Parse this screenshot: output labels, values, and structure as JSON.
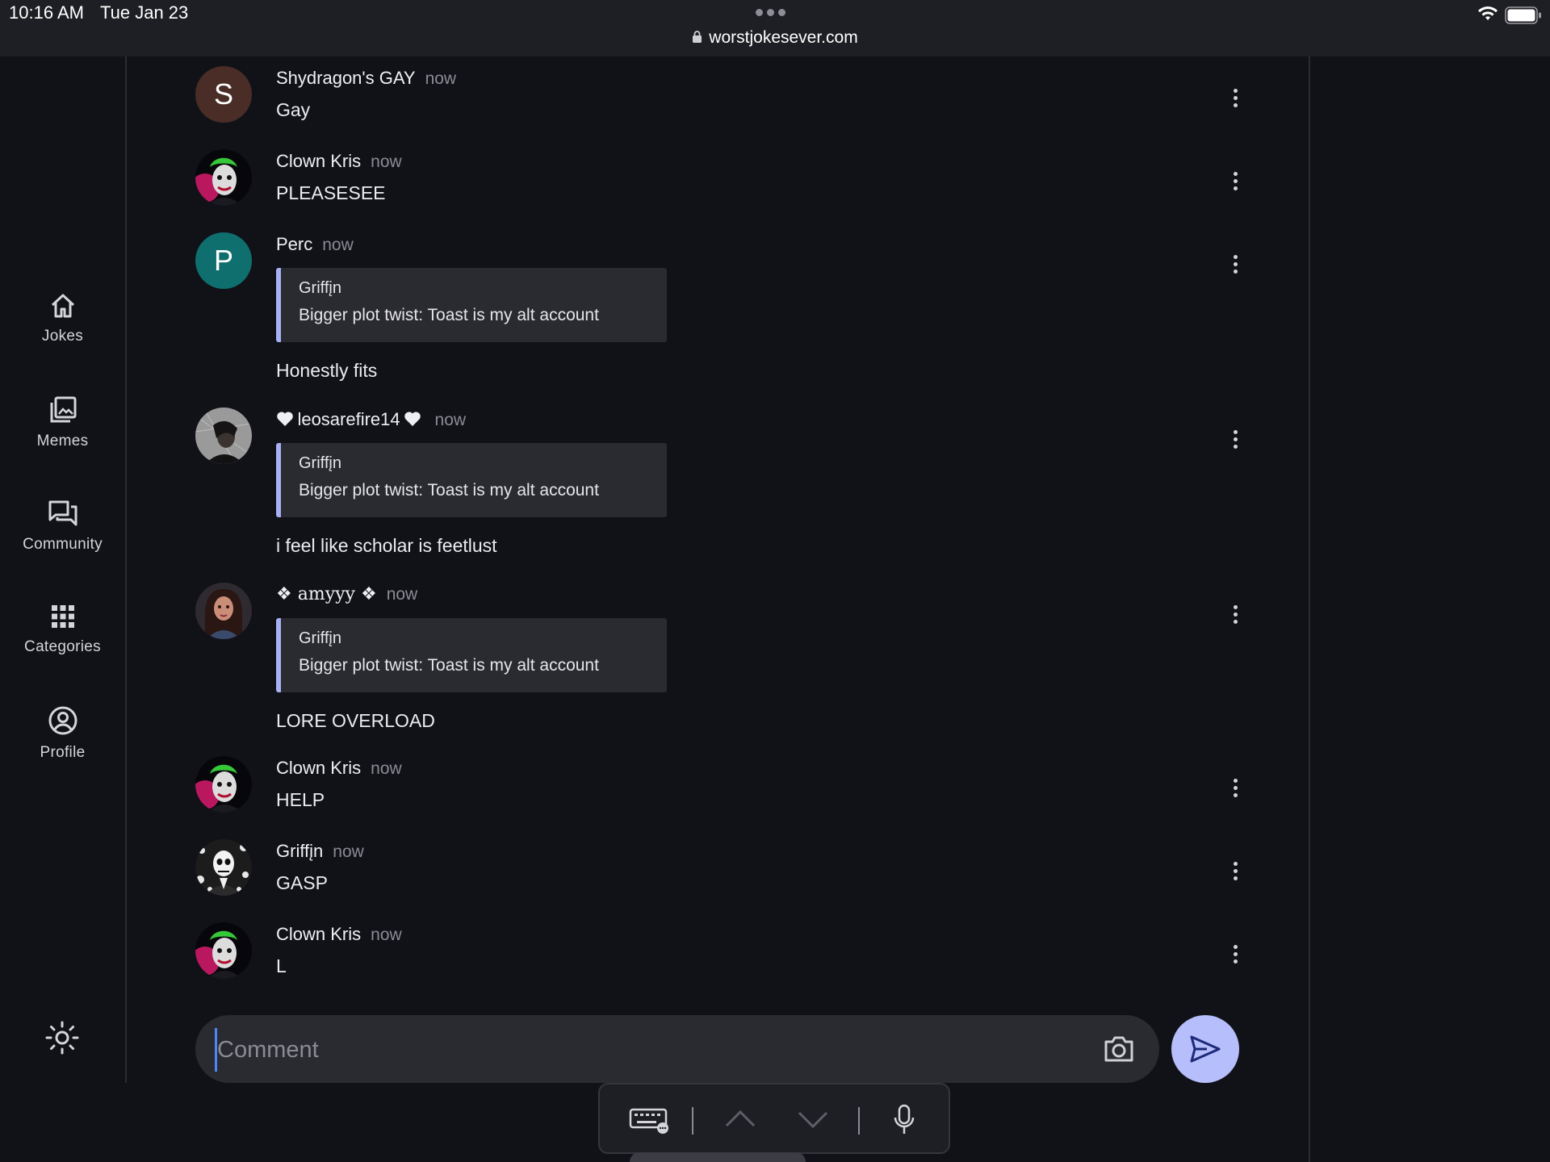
{
  "status_bar": {
    "time": "10:16 AM",
    "date": "Tue Jan 23",
    "url": "worstjokesever.com"
  },
  "sidebar": {
    "items": [
      {
        "label": "Jokes",
        "icon": "home-icon"
      },
      {
        "label": "Memes",
        "icon": "images-icon"
      },
      {
        "label": "Community",
        "icon": "forum-icon"
      },
      {
        "label": "Categories",
        "icon": "apps-grid-icon"
      },
      {
        "label": "Profile",
        "icon": "account-circle-icon"
      }
    ],
    "theme_icon": "sun-icon"
  },
  "messages": [
    {
      "author": "Shydragon's GAY",
      "time": "now",
      "avatar_letter": "S",
      "avatar_color": "#4a2d26",
      "text": "Gay"
    },
    {
      "author": "Clown Kris",
      "time": "now",
      "text": "PLEASESEE"
    },
    {
      "author": "Perc",
      "time": "now",
      "avatar_letter": "P",
      "avatar_color": "#0f6e6e",
      "quote": {
        "author": "Griffįn",
        "text": "Bigger plot twist: Toast is my alt account"
      },
      "text": "Honestly fits"
    },
    {
      "author": "leosarefire14",
      "time": "now",
      "quote": {
        "author": "Griffįn",
        "text": "Bigger plot twist: Toast is my alt account"
      },
      "text": "i feel like scholar is feetlust"
    },
    {
      "author": "❖ amyyy ❖",
      "time": "now",
      "quote": {
        "author": "Griffįn",
        "text": "Bigger plot twist: Toast is my alt account"
      },
      "text": "LORE OVERLOAD"
    },
    {
      "author": "Clown Kris",
      "time": "now",
      "text": "HELP"
    },
    {
      "author": "Griffįn",
      "time": "now",
      "text": "GASP"
    },
    {
      "author": "Clown Kris",
      "time": "now",
      "text": "L"
    }
  ],
  "composer": {
    "placeholder": "Comment",
    "value": ""
  },
  "colors": {
    "background": "#111217",
    "accent": "#b6befb",
    "quote_bar": "#a6b0f4",
    "bubble": "#2a2b30"
  }
}
